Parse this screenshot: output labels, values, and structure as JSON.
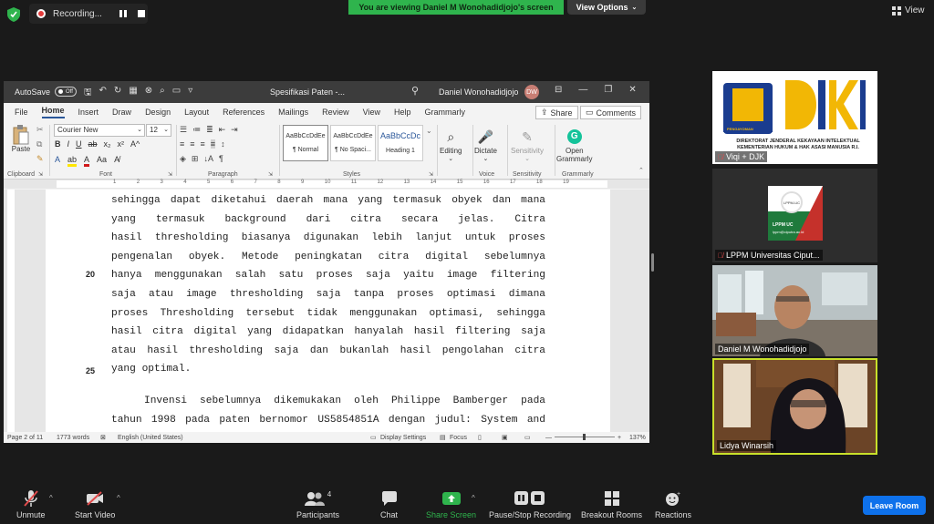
{
  "zoom_top": {
    "recording_label": "Recording...",
    "viewing_banner": "You are viewing Daniel M Wonohadidjojo's screen",
    "view_options": "View Options",
    "view_label": "View"
  },
  "word": {
    "autosave_label": "AutoSave",
    "autosave_state": "Off",
    "document_title": "Spesifikasi Paten -...",
    "user_name": "Daniel Wonohadidjojo",
    "user_initials": "DW",
    "tabs": [
      "File",
      "Home",
      "Insert",
      "Draw",
      "Design",
      "Layout",
      "References",
      "Mailings",
      "Review",
      "View",
      "Help",
      "Grammarly"
    ],
    "active_tab": "Home",
    "share_label": "Share",
    "comments_label": "Comments",
    "ribbon": {
      "paste": "Paste",
      "font_name": "Courier New",
      "font_size": "12",
      "styles": [
        {
          "preview": "AaBbCcDdEe",
          "name": "¶ Normal"
        },
        {
          "preview": "AaBbCcDdEe",
          "name": "¶ No Spaci..."
        },
        {
          "preview": "AaBbCcDc",
          "name": "Heading 1"
        }
      ],
      "editing": "Editing",
      "dictate": "Dictate",
      "sensitivity": "Sensitivity",
      "open_grammarly_1": "Open",
      "open_grammarly_2": "Grammarly",
      "groups": {
        "clipboard": "Clipboard",
        "font": "Font",
        "paragraph": "Paragraph",
        "styles": "Styles",
        "voice": "Voice",
        "sensitivity": "Sensitivity",
        "grammarly": "Grammarly"
      }
    },
    "line_numbers": {
      "n20": "20",
      "n25": "25"
    },
    "lines": [
      "sehingga dapat diketahui daerah mana yang termasuk obyek dan mana",
      "yang termasuk background dari citra secara jelas. Citra",
      "hasil thresholding biasanya digunakan lebih lanjut untuk proses",
      "pengenalan obyek. Metode peningkatan citra digital sebelumnya",
      "hanya menggunakan salah satu proses saja yaitu image filtering",
      "saja atau image thresholding saja tanpa proses optimasi dimana",
      "proses Thresholding tersebut tidak menggunakan optimasi, sehingga",
      "hasil citra digital yang didapatkan hanyalah hasil filtering saja",
      "atau hasil thresholding saja dan bukanlah hasil pengolahan citra",
      "yang optimal."
    ],
    "para2_lines": [
      "Invensi sebelumnya dikemukakan oleh Philippe Bamberger pada",
      "tahun 1998 pada paten bernomor US5854851A dengan judul: System and"
    ],
    "status": {
      "page": "Page 2 of 11",
      "words": "1773 words",
      "language": "English (United States)",
      "display_settings": "Display Settings",
      "focus": "Focus",
      "zoom": "137%"
    }
  },
  "participants": [
    {
      "name": "Viqi + DJK",
      "muted": true
    },
    {
      "name": "LPPM Universitas Ciput...",
      "muted": true
    },
    {
      "name": "Daniel M Wonohadidjojo",
      "muted": false
    },
    {
      "name": "Lidya Winarsih",
      "muted": false
    }
  ],
  "djki_caption": "DIREKTORAT JENDERAL KEKAYAAN INTELEKTUAL KEMENTERIAN HUKUM & HAK ASASI MANUSIA R.I.",
  "djki_badge": "PENGAYOMAN",
  "lppm_logo": {
    "circle": "LPPM-UC",
    "name": "LPPM UC",
    "email": "lppm@ciputra.ac.id"
  },
  "toolbar": {
    "unmute": "Unmute",
    "start_video": "Start Video",
    "participants": "Participants",
    "participants_count": "4",
    "chat": "Chat",
    "share_screen": "Share Screen",
    "pause_recording": "Pause/Stop Recording",
    "breakout": "Breakout Rooms",
    "reactions": "Reactions",
    "leave": "Leave Room"
  },
  "colors": {
    "zoom_green": "#2fb44d",
    "leave_blue": "#0e71eb",
    "word_accent": "#2b579a",
    "active_speaker_border": "#c8e02a"
  }
}
